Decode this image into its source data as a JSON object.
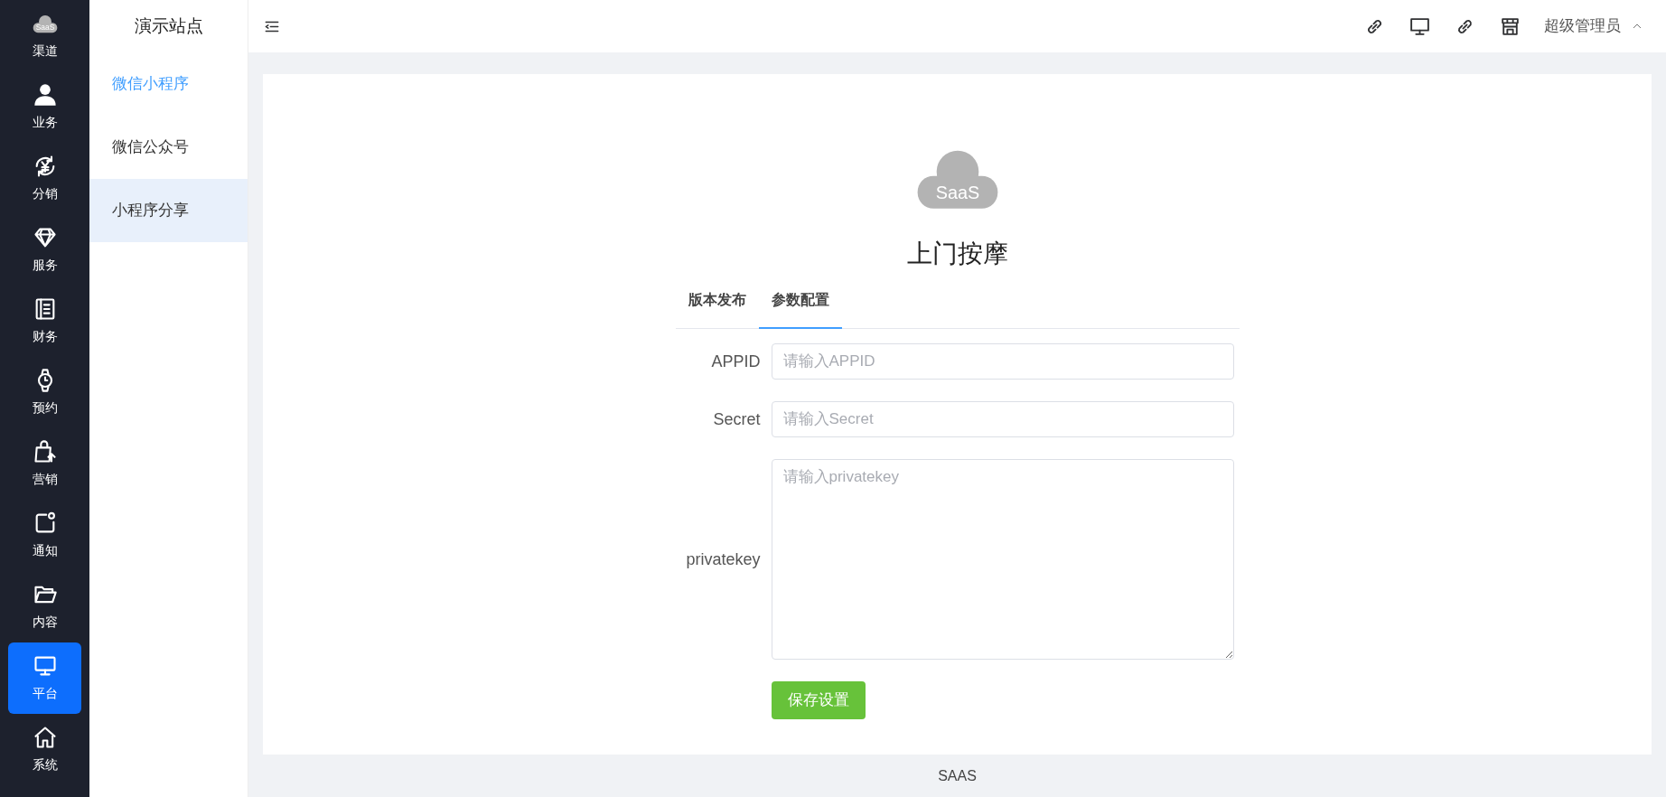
{
  "sidebar": {
    "items": [
      {
        "kind": "logo",
        "logo_text": "SaaS",
        "label": "渠道",
        "selected": false
      },
      {
        "kind": "icon",
        "label": "业务",
        "selected": false
      },
      {
        "kind": "icon",
        "label": "分销",
        "selected": false
      },
      {
        "kind": "icon",
        "label": "服务",
        "selected": false
      },
      {
        "kind": "icon",
        "label": "财务",
        "selected": false
      },
      {
        "kind": "icon",
        "label": "预约",
        "selected": false
      },
      {
        "kind": "icon",
        "label": "营销",
        "selected": false
      },
      {
        "kind": "icon",
        "label": "通知",
        "selected": false
      },
      {
        "kind": "icon",
        "label": "内容",
        "selected": false
      },
      {
        "kind": "icon",
        "label": "平台",
        "selected": true
      },
      {
        "kind": "icon",
        "label": "系统",
        "selected": false
      }
    ]
  },
  "submenu": {
    "title": "演示站点",
    "items": [
      {
        "label": "微信小程序",
        "selected": true,
        "hovered": false
      },
      {
        "label": "微信公众号",
        "selected": false,
        "hovered": false
      },
      {
        "label": "小程序分享",
        "selected": false,
        "hovered": true
      }
    ]
  },
  "header": {
    "user": "超级管理员"
  },
  "app": {
    "logo_text": "SaaS",
    "name": "上门按摩"
  },
  "tabs": [
    {
      "label": "版本发布",
      "selected": false
    },
    {
      "label": "参数配置",
      "selected": true
    }
  ],
  "form": {
    "fields": [
      {
        "kind": "input",
        "label": "APPID",
        "placeholder": "请输入APPID"
      },
      {
        "kind": "input",
        "label": "Secret",
        "placeholder": "请输入Secret"
      },
      {
        "kind": "textarea",
        "label": "privatekey",
        "placeholder": "请输入privatekey"
      }
    ],
    "submit": "保存设置"
  },
  "footer": "SAAS"
}
